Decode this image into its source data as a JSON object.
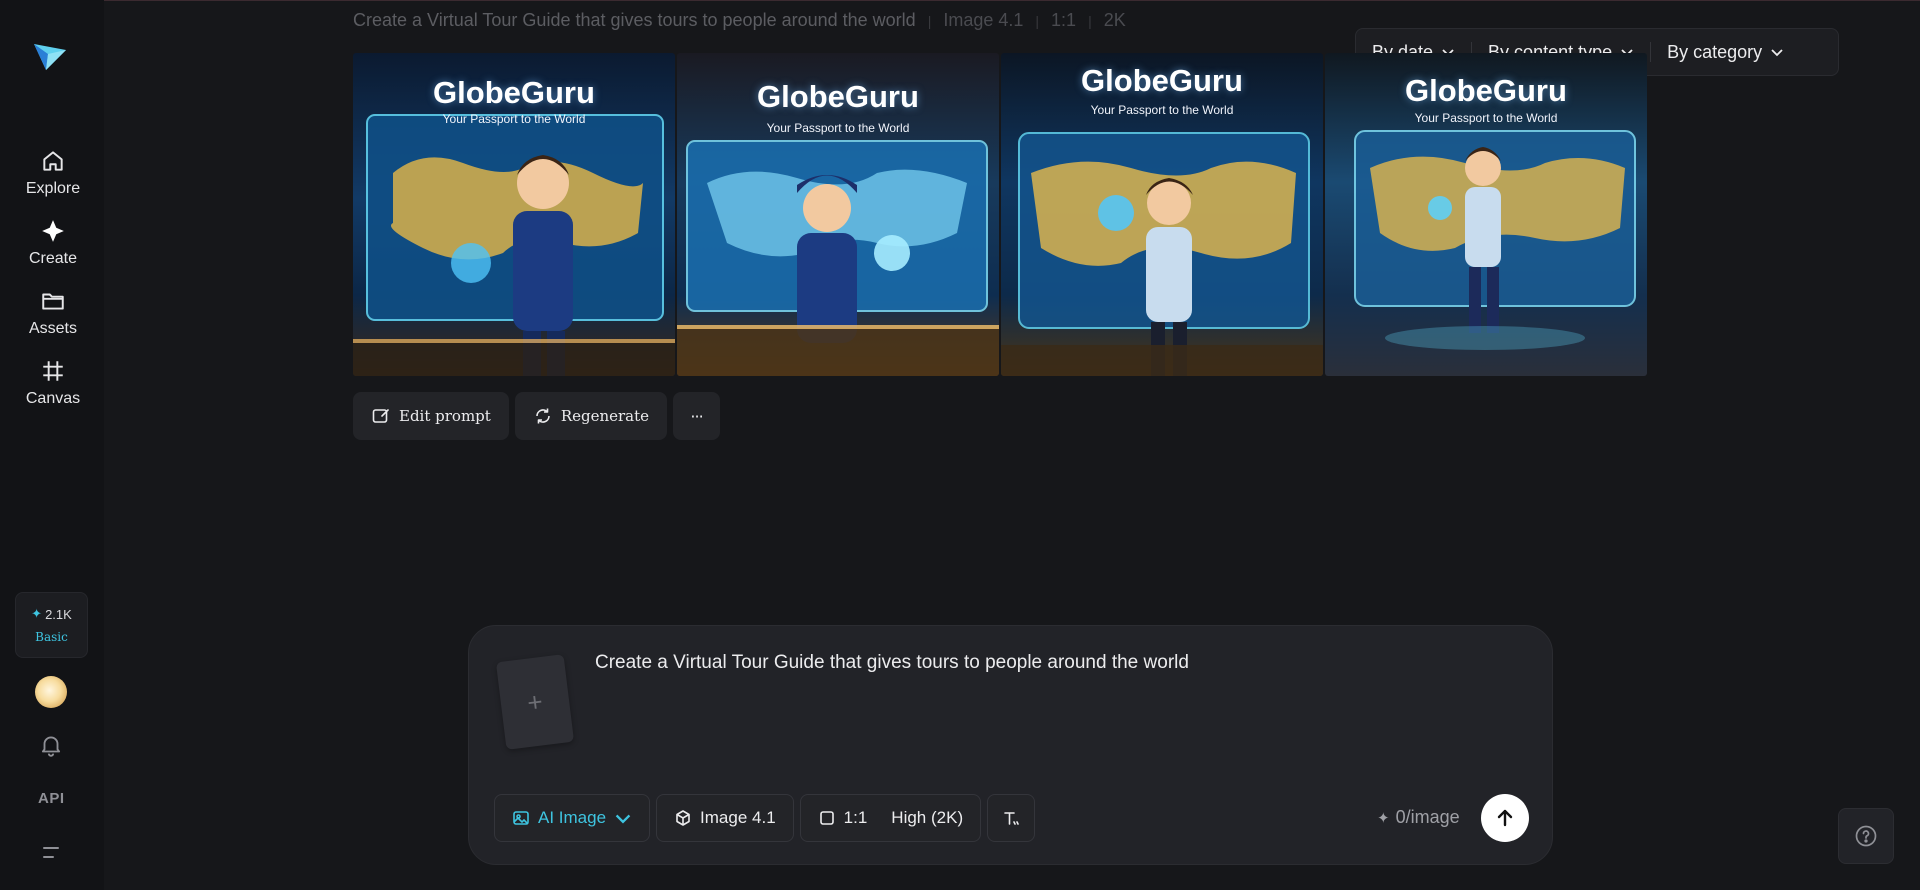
{
  "nav": {
    "items": [
      {
        "label": "Explore",
        "icon": "home-icon"
      },
      {
        "label": "Create",
        "icon": "sparkle-icon"
      },
      {
        "label": "Assets",
        "icon": "folder-icon"
      },
      {
        "label": "Canvas",
        "icon": "canvas-icon"
      }
    ],
    "credits": {
      "amount": "2.1K",
      "plan": "Basic"
    },
    "api_label": "API"
  },
  "header": {
    "prompt": "Create a Virtual Tour Guide that gives tours to people around the world",
    "model": "Image 4.1",
    "ratio": "1:1",
    "resolution": "2K"
  },
  "filters": {
    "by_date": "By date",
    "by_content_type": "By content type",
    "by_category": "By category"
  },
  "images": [
    {
      "title": "GlobeGuru",
      "subtitle": "Your Passport to the World"
    },
    {
      "title": "GlobeGuru",
      "subtitle": "Your Passport to the World"
    },
    {
      "title": "GlobeGuru",
      "subtitle": "Your Passport to the World"
    },
    {
      "title": "GlobeGuru",
      "subtitle": "Your Passport to the World"
    }
  ],
  "actions": {
    "edit_prompt": "Edit prompt",
    "regenerate": "Regenerate",
    "more": "···"
  },
  "composer": {
    "upload_symbol": "+",
    "prompt": "Create a Virtual Tour Guide that gives tours to people around the world",
    "mode": "AI Image",
    "model": "Image 4.1",
    "ratio": "1:1",
    "quality": "High (2K)",
    "cost": "0/image"
  },
  "colors": {
    "accent": "#3ec4e0",
    "background": "#16171a",
    "panel": "#222328"
  }
}
